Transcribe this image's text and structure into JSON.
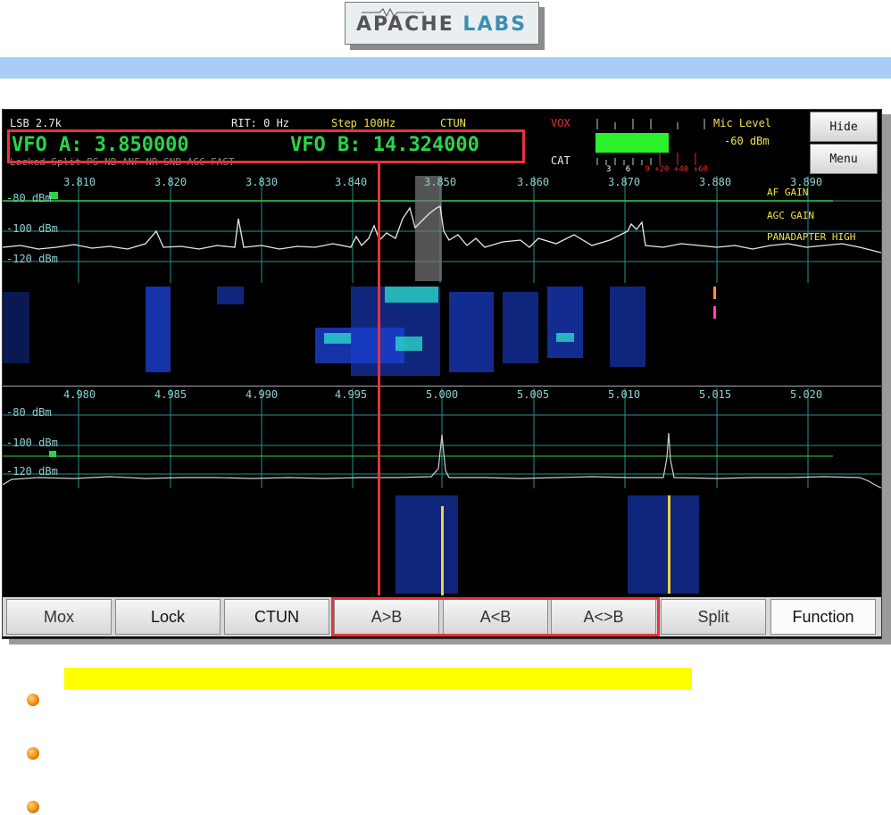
{
  "logo": {
    "brand_part1": "APACHE",
    "brand_part2": "LABS"
  },
  "top_status": {
    "mode": "LSB 2.7k",
    "rit": "RIT: 0 Hz",
    "step": "Step 100Hz",
    "ctun": "CTUN",
    "vox": "VOX",
    "cat": "CAT",
    "mic_level_label": "Mic Level",
    "mic_level_value": "-60 dBm",
    "meter_scale": [
      "3",
      "6",
      "9",
      "+20",
      "+40",
      "+60"
    ],
    "status_line": "Locked Split PS NB ANF NR SNB AGC FAST"
  },
  "vfo": {
    "a": "VFO A: 3.850000",
    "b": "VFO B: 14.324000"
  },
  "side_buttons": {
    "hide": "Hide",
    "menu": "Menu"
  },
  "panadapter1": {
    "freq_ticks": [
      "3.810",
      "3.820",
      "3.830",
      "3.840",
      "3.850",
      "3.860",
      "3.870",
      "3.880",
      "3.890"
    ],
    "db_labels": [
      "-80 dBm",
      "-100 dBm",
      "-120 dBm"
    ],
    "overlay_labels": [
      "AF GAIN",
      "AGC GAIN",
      "PANADAPTER HIGH"
    ]
  },
  "panadapter2": {
    "freq_ticks": [
      "4.980",
      "4.985",
      "4.990",
      "4.995",
      "5.000",
      "5.005",
      "5.010",
      "5.015",
      "5.020"
    ],
    "db_labels": [
      "-80 dBm",
      "-100 dBm",
      "-120 dBm"
    ]
  },
  "bottom_buttons": [
    "Mox",
    "Lock",
    "CTUN",
    "A>B",
    "A<B",
    "A<>B",
    "Split",
    "Function"
  ],
  "colors": {
    "highlight": "#e8323c",
    "spectrum_grid": "#2a8f8f",
    "vfo_text": "#2bd34a",
    "band_blue": "#a9cdf5"
  }
}
